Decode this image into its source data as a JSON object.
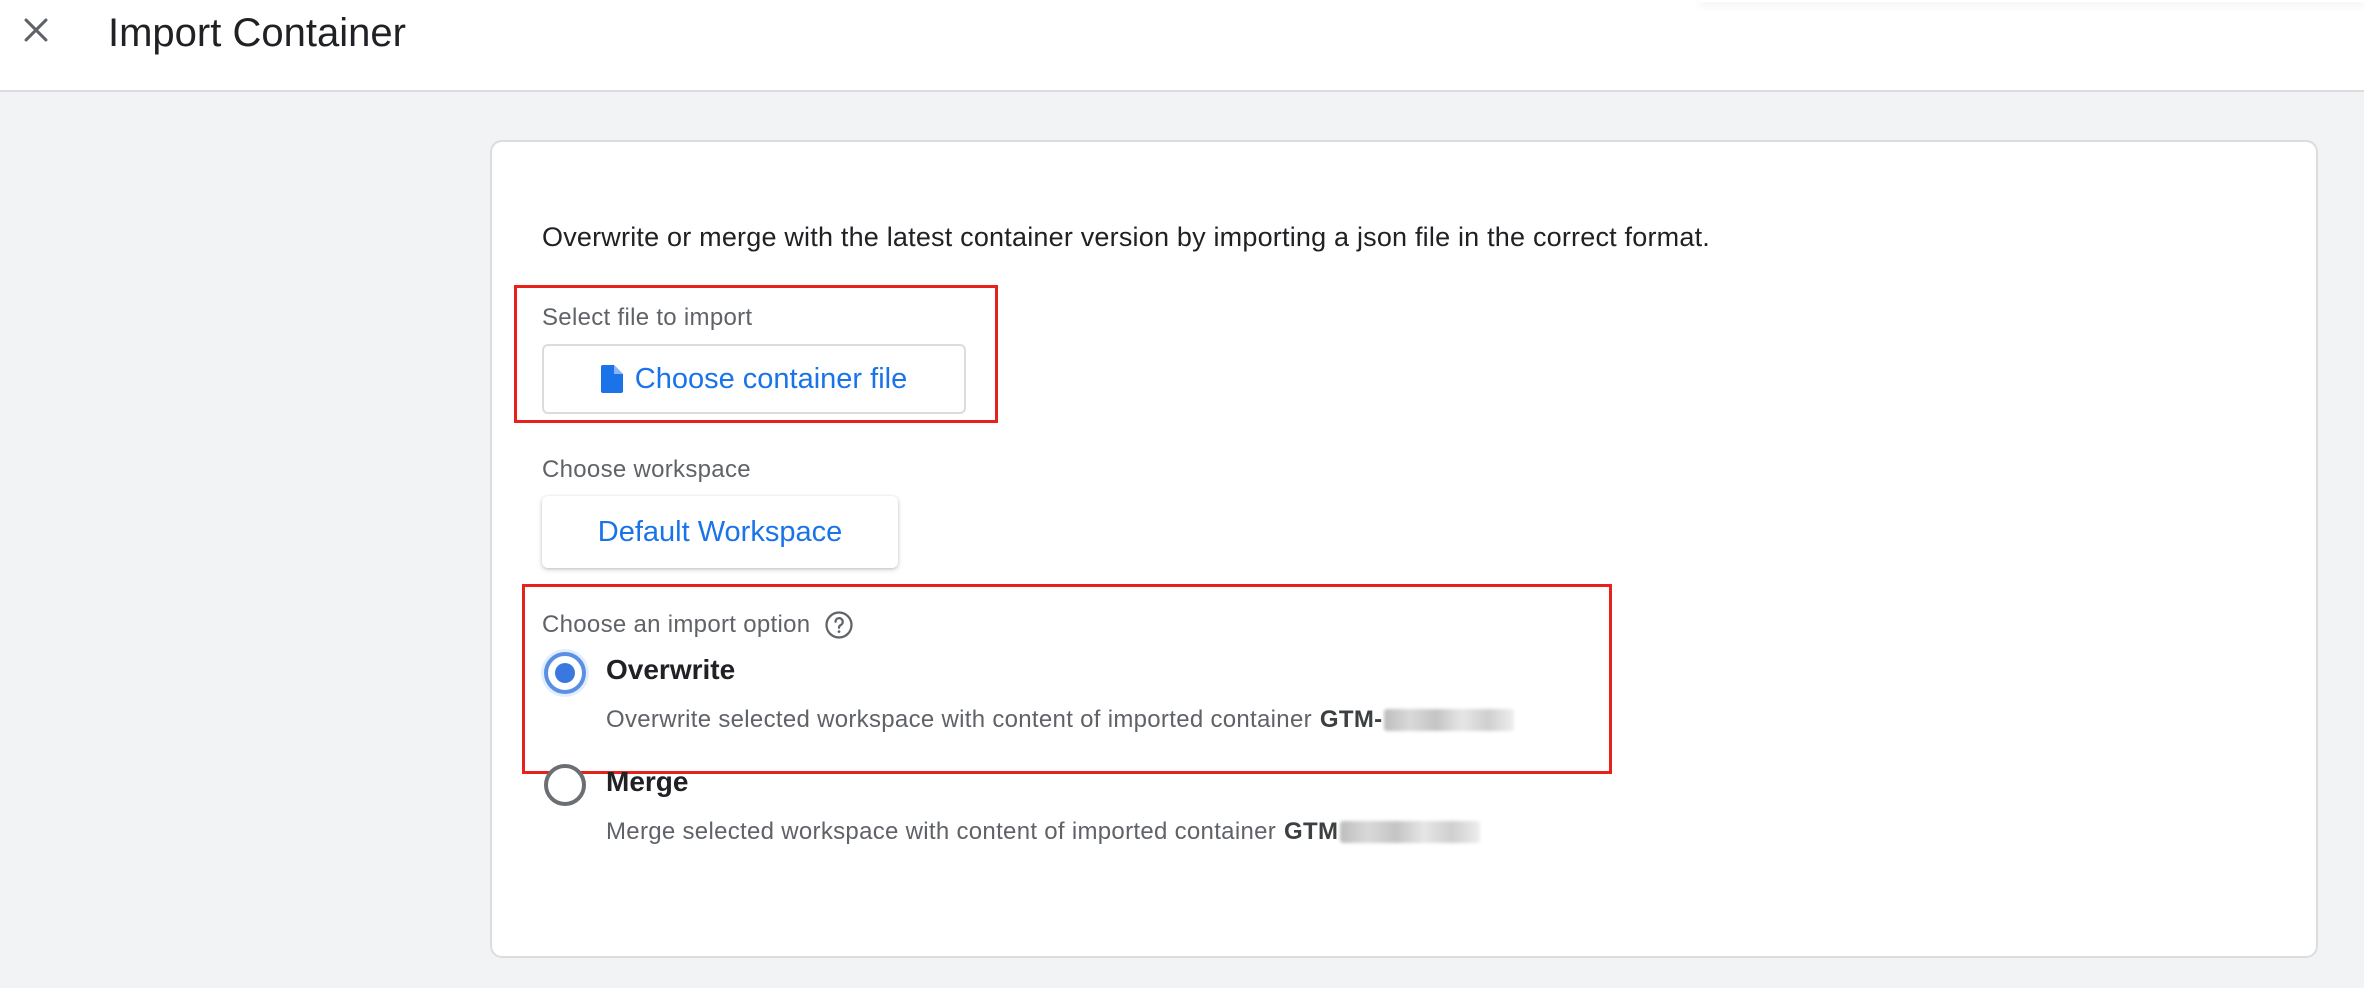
{
  "header": {
    "title": "Import Container",
    "close_icon": "close-icon"
  },
  "card": {
    "description": "Overwrite or merge with the latest container version by importing a json file in the correct format.",
    "file_section": {
      "label": "Select file to import",
      "button_label": "Choose container file",
      "button_icon": "file-icon"
    },
    "workspace_section": {
      "label": "Choose workspace",
      "button_label": "Default Workspace"
    },
    "import_section": {
      "label": "Choose an import option",
      "help_icon": "help-circle-icon",
      "options": [
        {
          "title": "Overwrite",
          "description": "Overwrite selected workspace with content of imported container",
          "container_id": "GTM-",
          "selected": true
        },
        {
          "title": "Merge",
          "description": "Merge selected workspace with content of imported container",
          "container_id": "GTM",
          "selected": false
        }
      ]
    }
  },
  "colors": {
    "accent": "#1a73e8",
    "highlight": "#e8211a",
    "background": "#f1f3f4"
  }
}
